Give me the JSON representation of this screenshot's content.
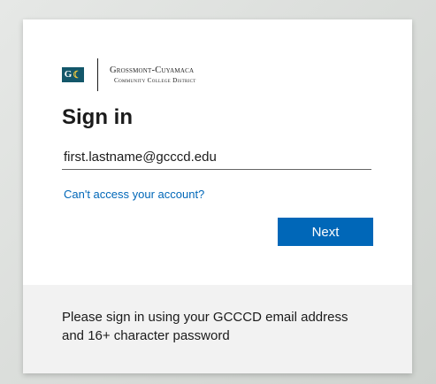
{
  "logo": {
    "mark_letter": "G",
    "mark_moon": "☾",
    "name_line1": "Grossmont-Cuyamaca",
    "name_line2": "Community College District",
    "brand_color": "#13576a",
    "accent_color": "#f0c93d"
  },
  "signin": {
    "title": "Sign in",
    "email_value": "first.lastname@gcccd.edu",
    "cant_access_link": "Can't access your account?",
    "next_button": "Next"
  },
  "footer": {
    "message": "Please sign in using your GCCCD email address and 16+ character password"
  },
  "colors": {
    "primary_button": "#0067b8",
    "link": "#0067b8",
    "footer_bg": "#f2f2f2"
  }
}
